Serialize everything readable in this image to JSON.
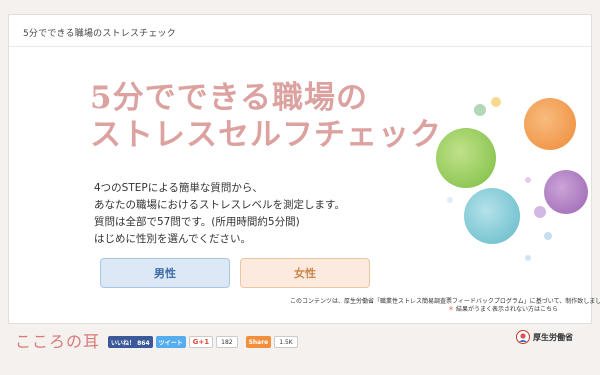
{
  "window": {
    "title": "5分でできる職場のストレスチェック"
  },
  "hero": {
    "title": "5分でできる職場の\nストレスセルフチェック"
  },
  "description": {
    "lines": [
      "4つのSTEPによる簡単な質問から、",
      "あなたの職場におけるストレスレベルを測定します。",
      "質問は全部で57問です。(所用時間約5分間)",
      "はじめに性別を選んでください。"
    ]
  },
  "buttons": {
    "male": "男性",
    "female": "女性"
  },
  "notes": {
    "basis": "このコンテンツは、厚生労働省「職業性ストレス簡易調査票フィードバックプログラム」に基づいて、制作致しました。",
    "display_mark": "＊",
    "display_issue": "結果がうまく表示されない方はこちら"
  },
  "footer": {
    "logo": "こころの耳",
    "facebook_label": "いいね！ 864",
    "tweet_label": "ツイート",
    "gplus_label": "G+1",
    "gplus_count": "182",
    "share_label": "Share",
    "share_count": "1.5K",
    "ministry": "厚生労働省"
  },
  "colors": {
    "hero_title": "#dba2a0",
    "male_button_bg": "#dce8f5",
    "female_button_bg": "#fbeadd",
    "bubble_green": "#8cc63f",
    "bubble_orange": "#f0923a",
    "bubble_purple": "#a46bb8",
    "bubble_teal": "#69c1cf"
  }
}
